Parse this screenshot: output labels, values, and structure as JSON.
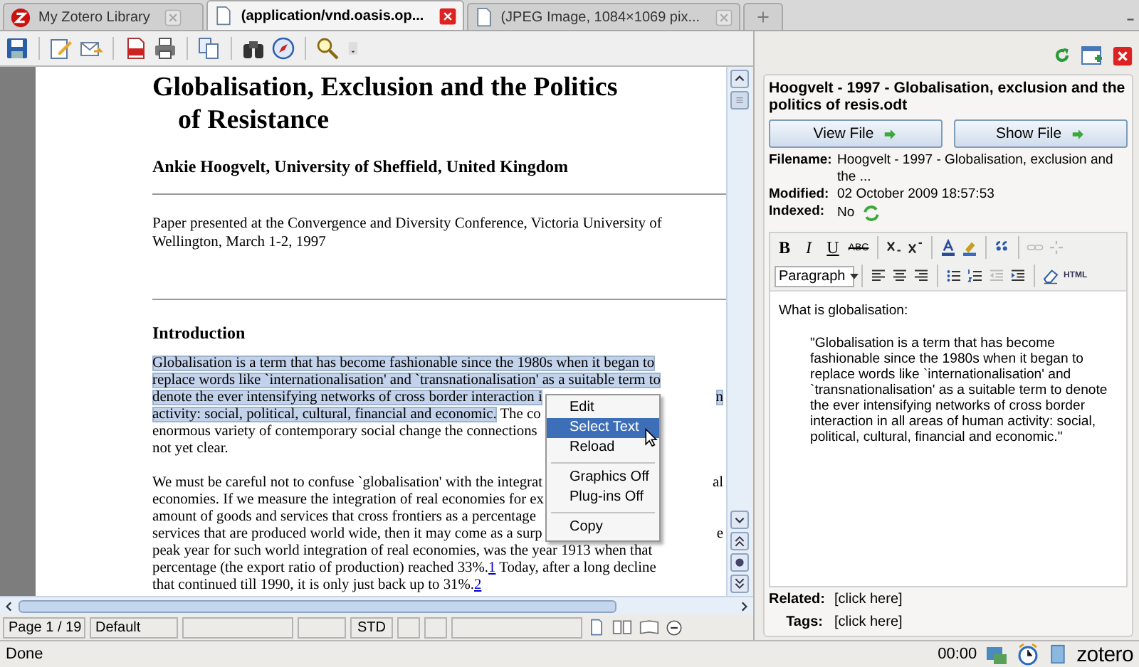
{
  "tabs": [
    {
      "label": "My Zotero Library",
      "selected": false
    },
    {
      "label": "(application/vnd.oasis.op...",
      "selected": true
    },
    {
      "label": "(JPEG Image, 1084×1069 pix...",
      "selected": false
    }
  ],
  "document": {
    "title_lines": [
      "Globalisation, Exclusion and the Politics",
      "of Resistance"
    ],
    "author": "Ankie Hoogvelt, University of Sheffield, United Kingdom",
    "note_lines": [
      "Paper presented at the Convergence and Diversity Conference, Victoria University of",
      "Wellington, March 1-2, 1997"
    ],
    "heading": "Introduction",
    "paragraphs": [
      {
        "lines": [
          {
            "left": [
              {
                "kind": "text",
                "text": "Globalisation is a term that has become fashionable since the 1980s when it began to",
                "highlighted": true
              }
            ]
          },
          {
            "left": [
              {
                "kind": "text",
                "text": "replace words like `internationalisation' and `transnationalisation' as a suitable term to",
                "highlighted": true
              }
            ]
          },
          {
            "left": [
              {
                "kind": "text",
                "text": "denote the ever intensifying networks of cross border interaction i",
                "highlighted": true
              }
            ],
            "right": [
              {
                "kind": "text",
                "text": "n",
                "highlighted": true
              }
            ]
          },
          {
            "left": [
              {
                "kind": "text",
                "text": "activity: social, political, cultural, financial and economic.",
                "highlighted": true
              },
              {
                "kind": "text",
                "text": " The co",
                "highlighted": false
              }
            ]
          },
          {
            "left": [
              {
                "kind": "text",
                "text": "enormous variety of contemporary social change the connections",
                "highlighted": false
              }
            ]
          },
          {
            "left": [
              {
                "kind": "text",
                "text": "not yet clear.",
                "highlighted": false
              }
            ]
          }
        ]
      },
      {
        "lines": [
          {
            "left": [
              {
                "kind": "text",
                "text": "We must be careful not to confuse `globalisation' with the integrat",
                "highlighted": false
              }
            ],
            "right": [
              {
                "kind": "text",
                "text": "al",
                "highlighted": false
              }
            ]
          },
          {
            "left": [
              {
                "kind": "text",
                "text": "economies. If we measure the integration of real economies for ex",
                "highlighted": false
              }
            ]
          },
          {
            "left": [
              {
                "kind": "text",
                "text": "amount of goods and services that cross frontiers as a percentage",
                "highlighted": false
              }
            ]
          },
          {
            "left": [
              {
                "kind": "text",
                "text": "services that are produced world wide, then it may come as a surp",
                "highlighted": false
              }
            ],
            "right": [
              {
                "kind": "text",
                "text": "e",
                "highlighted": false
              }
            ]
          },
          {
            "left": [
              {
                "kind": "text",
                "text": "peak year for such world integration of real economies, was the year 1913 when that",
                "highlighted": false
              }
            ]
          },
          {
            "left": [
              {
                "kind": "text",
                "text": "percentage (the export ratio of production) reached 33%.",
                "highlighted": false
              },
              {
                "kind": "link",
                "text": "1",
                "highlighted": false
              },
              {
                "kind": "text",
                "text": " Today, after a long decline",
                "highlighted": false
              }
            ]
          },
          {
            "left": [
              {
                "kind": "text",
                "text": "that continued till 1990, it is only just back up to 31%.",
                "highlighted": false
              },
              {
                "kind": "link",
                "text": "2",
                "highlighted": false
              }
            ]
          }
        ]
      }
    ]
  },
  "context_menu": {
    "items": [
      {
        "kind": "item",
        "label": "Edit",
        "selected": false
      },
      {
        "kind": "item",
        "label": "Select Text",
        "selected": true
      },
      {
        "kind": "item",
        "label": "Reload",
        "selected": false
      },
      {
        "kind": "separator"
      },
      {
        "kind": "item",
        "label": "Graphics Off",
        "selected": false
      },
      {
        "kind": "item",
        "label": "Plug-ins Off",
        "selected": false
      },
      {
        "kind": "separator"
      },
      {
        "kind": "item",
        "label": "Copy",
        "selected": false
      }
    ]
  },
  "sidebar": {
    "title": "Hoogvelt - 1997 - Globalisation, exclusion and the politics of resis.odt",
    "buttons": [
      "View File",
      "Show File"
    ],
    "fields": [
      {
        "label": "Filename:",
        "value": "Hoogvelt - 1997 - Globalisation, exclusion and the ..."
      },
      {
        "label": "Modified:",
        "value": "02 October 2009 18:57:53"
      },
      {
        "label": "Indexed:",
        "value": "No"
      }
    ],
    "editor": {
      "format_buttons": [
        {
          "kind": "bold",
          "label": "B"
        },
        {
          "kind": "italic",
          "label": "I"
        },
        {
          "kind": "underline",
          "label": "U"
        },
        {
          "kind": "strike",
          "label": "ABC"
        }
      ],
      "block_format": "Paragraph",
      "html_button": "HTML",
      "heading": "What is globalisation:",
      "quote": "\"Globalisation is a term that has become fashionable since the 1980s when it began to replace words like `internationalisation' and `transnationalisation' as a suitable term to denote the ever intensifying networks of cross border interaction in all areas of human activity: social, political, cultural, financial and economic.\""
    },
    "links": [
      {
        "label": "Related:",
        "value": "[click here]"
      },
      {
        "label": "Tags:",
        "value": "[click here]"
      }
    ]
  },
  "doc_status": {
    "page": "Page 1 / 19",
    "style": "Default",
    "mode": "STD"
  },
  "status_bar": {
    "text": "Done",
    "time": "00:00",
    "brand": "zotero"
  }
}
